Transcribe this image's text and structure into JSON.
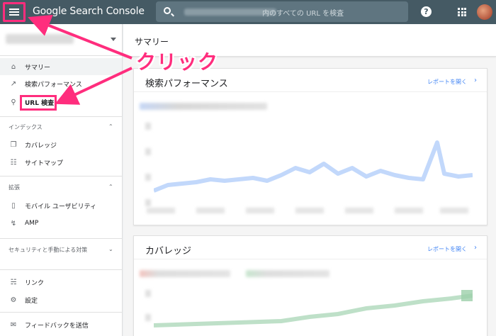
{
  "header": {
    "menu_icon": "hamburger-menu-icon",
    "app_title": "Google Search Console",
    "search_placeholder": "内のすべての URL を検査",
    "help_label": "?"
  },
  "sidebar": {
    "nav": [
      {
        "label": "サマリー",
        "icon": "home-icon"
      },
      {
        "label": "検索パフォーマンス",
        "icon": "trending-up-icon"
      },
      {
        "label": "URL 検査",
        "icon": "search-icon"
      }
    ],
    "index_section": "インデックス",
    "index_items": [
      {
        "label": "カバレッジ",
        "icon": "copy-icon"
      },
      {
        "label": "サイトマップ",
        "icon": "sitemap-icon"
      }
    ],
    "enhance_section": "拡張",
    "enhance_items": [
      {
        "label": "モバイル ユーザビリティ",
        "icon": "smartphone-icon"
      },
      {
        "label": "AMP",
        "icon": "bolt-icon"
      }
    ],
    "security_section": "セキュリティと手動による対策",
    "bottom_items": [
      {
        "label": "リンク",
        "icon": "links-icon"
      },
      {
        "label": "設定",
        "icon": "gear-icon"
      },
      {
        "label": "フィードバックを送信",
        "icon": "feedback-icon"
      }
    ]
  },
  "main": {
    "page_title": "サマリー",
    "cards": [
      {
        "title": "検索パフォーマンス",
        "link": "レポートを開く"
      },
      {
        "title": "カバレッジ",
        "link": "レポートを開く"
      }
    ]
  },
  "annotation": {
    "text": "クリック",
    "color": "#ff2d7d"
  },
  "colors": {
    "topbar": "#455a64",
    "accent_link": "#4285f4",
    "perf_line": "#a8c7fa",
    "coverage_line": "#a8d5b5"
  }
}
